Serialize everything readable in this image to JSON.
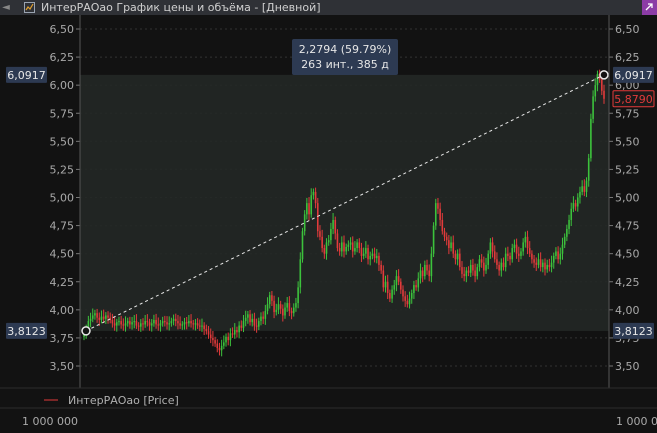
{
  "window": {
    "title": "ИнтерРАОао График цены и объёма - [Дневной]",
    "left_marker": "◄",
    "logo_icon": "app-logo-icon",
    "pin_icon": "link-icon"
  },
  "chart_data": {
    "type": "candlestick",
    "ylim": [
      3.4,
      6.6
    ],
    "y_ticks": [
      "6,50",
      "6,25",
      "6,00",
      "5,75",
      "5,50",
      "5,25",
      "5,00",
      "4,75",
      "4,50",
      "4,25",
      "4,00",
      "3,75",
      "3,50"
    ],
    "y_tick_values": [
      6.5,
      6.25,
      6.0,
      5.75,
      5.5,
      5.25,
      5.0,
      4.75,
      4.5,
      4.25,
      4.0,
      3.75,
      3.5
    ],
    "grid": true,
    "range_box": {
      "low": 3.8123,
      "high": 6.0917,
      "low_label": "3,8123",
      "high_label": "6,0917"
    },
    "last_price": {
      "value": 5.879,
      "label": "5,8790"
    },
    "measurement": {
      "line1": "2,2794 (59.79%)",
      "line2": "263 инт., 385 д"
    },
    "legend": {
      "series_name": "ИнтерРАОао [Price]",
      "position": "bottom-left"
    },
    "volume_axis_label": "1 000 000",
    "colors": {
      "up": "#3cc23c",
      "down": "#e23b3b",
      "background": "#121212",
      "grid": "#3a3a3a",
      "range_fill": "#232826",
      "tooltip": "#2d3a52"
    },
    "close_series": [
      3.78,
      3.83,
      3.9,
      3.92,
      3.95,
      3.97,
      3.93,
      3.91,
      3.94,
      3.92,
      3.95,
      3.93,
      3.91,
      3.88,
      3.86,
      3.89,
      3.9,
      3.87,
      3.86,
      3.88,
      3.9,
      3.87,
      3.89,
      3.9,
      3.86,
      3.85,
      3.88,
      3.87,
      3.9,
      3.89,
      3.86,
      3.88,
      3.91,
      3.87,
      3.86,
      3.88,
      3.9,
      3.89,
      3.87,
      3.88,
      3.9,
      3.92,
      3.9,
      3.88,
      3.86,
      3.87,
      3.89,
      3.88,
      3.9,
      3.88,
      3.87,
      3.88,
      3.86,
      3.85,
      3.86,
      3.83,
      3.81,
      3.78,
      3.75,
      3.73,
      3.7,
      3.66,
      3.64,
      3.68,
      3.71,
      3.76,
      3.73,
      3.79,
      3.78,
      3.82,
      3.8,
      3.86,
      3.84,
      3.9,
      3.93,
      3.96,
      3.89,
      3.92,
      3.86,
      3.85,
      3.9,
      3.94,
      3.92,
      3.99,
      4.05,
      4.13,
      4.08,
      3.98,
      4.0,
      4.05,
      4.01,
      3.95,
      4.02,
      4.06,
      3.99,
      3.97,
      4.02,
      4.06,
      4.2,
      4.45,
      4.7,
      4.85,
      4.95,
      4.85,
      5.02,
      5.05,
      4.95,
      4.7,
      4.65,
      4.55,
      4.5,
      4.6,
      4.62,
      4.72,
      4.8,
      4.68,
      4.55,
      4.52,
      4.6,
      4.52,
      4.56,
      4.58,
      4.6,
      4.52,
      4.55,
      4.6,
      4.55,
      4.48,
      4.5,
      4.55,
      4.45,
      4.48,
      4.5,
      4.46,
      4.48,
      4.4,
      4.35,
      4.2,
      4.25,
      4.15,
      4.1,
      4.18,
      4.22,
      4.3,
      4.25,
      4.18,
      4.12,
      4.08,
      4.05,
      4.1,
      4.15,
      4.22,
      4.2,
      4.28,
      4.35,
      4.3,
      4.4,
      4.35,
      4.3,
      4.5,
      4.75,
      4.95,
      4.9,
      4.8,
      4.7,
      4.65,
      4.62,
      4.55,
      4.6,
      4.5,
      4.45,
      4.5,
      4.38,
      4.32,
      4.3,
      4.35,
      4.33,
      4.4,
      4.35,
      4.3,
      4.38,
      4.45,
      4.42,
      4.35,
      4.4,
      4.5,
      4.6,
      4.52,
      4.45,
      4.4,
      4.35,
      4.42,
      4.38,
      4.5,
      4.48,
      4.45,
      4.55,
      4.58,
      4.5,
      4.48,
      4.52,
      4.6,
      4.65,
      4.55,
      4.5,
      4.45,
      4.42,
      4.4,
      4.45,
      4.38,
      4.42,
      4.36,
      4.4,
      4.38,
      4.42,
      4.48,
      4.52,
      4.45,
      4.5,
      4.58,
      4.65,
      4.72,
      4.8,
      4.9,
      4.95,
      4.92,
      5.0,
      5.05,
      5.1,
      5.05,
      5.15,
      5.35,
      5.7,
      5.9,
      6.0,
      6.1,
      6.05,
      5.95,
      5.879
    ]
  }
}
